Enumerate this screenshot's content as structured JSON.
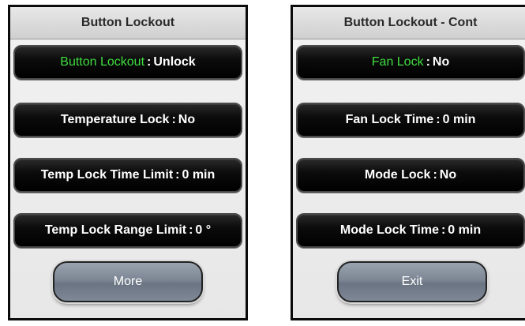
{
  "left_screen": {
    "title": "Button Lockout",
    "rows": [
      {
        "label": "Button Lockout",
        "value": "Unlock"
      },
      {
        "label": "Temperature Lock",
        "value": "No"
      },
      {
        "label": "Temp Lock Time Limit",
        "value": "0 min"
      },
      {
        "label": "Temp Lock Range Limit",
        "value": "0 °"
      }
    ],
    "button_label": "More"
  },
  "right_screen": {
    "title": "Button Lockout - Cont",
    "rows": [
      {
        "label": "Fan Lock",
        "value": "No"
      },
      {
        "label": "Fan Lock Time",
        "value": "0 min"
      },
      {
        "label": "Mode Lock",
        "value": "No"
      },
      {
        "label": "Mode Lock Time",
        "value": "0 min"
      }
    ],
    "button_label": "Exit"
  },
  "colors": {
    "selected_label": "#3fdd3f",
    "row_background": "#000000",
    "button_background": "#7c8694"
  }
}
